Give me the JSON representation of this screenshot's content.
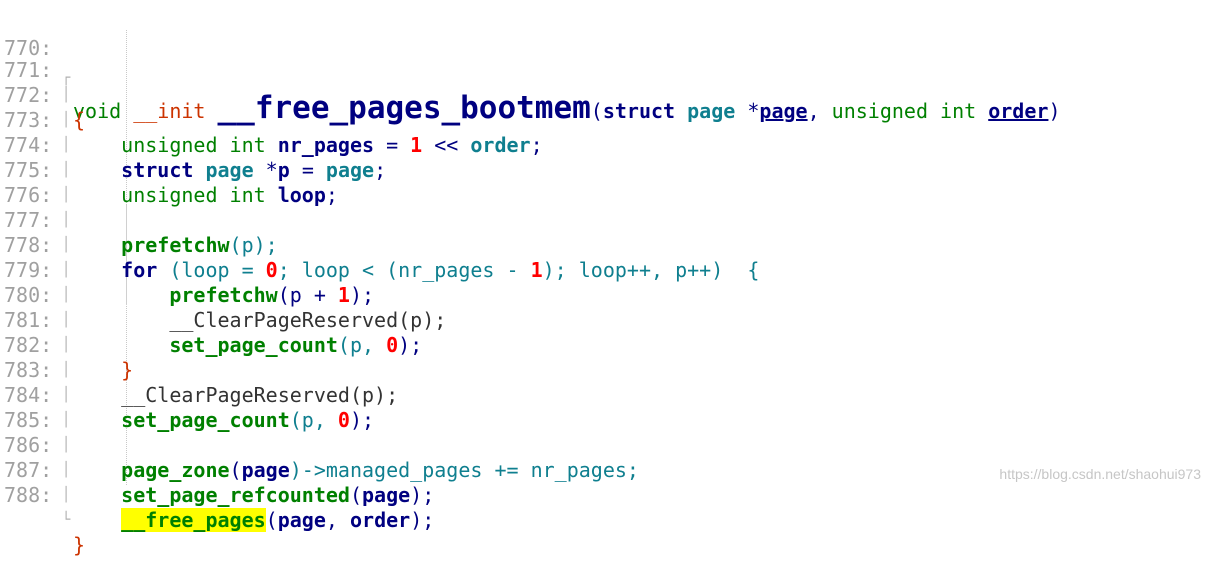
{
  "line_numbers": [
    "770:",
    "771:",
    "772:",
    "773:",
    "774:",
    "775:",
    "776:",
    "777:",
    "778:",
    "779:",
    "780:",
    "781:",
    "782:",
    "783:",
    "784:",
    "785:",
    "786:",
    "787:",
    "788:"
  ],
  "code": {
    "l770": {
      "void": "void",
      "init": "__init",
      "fn_name": "__free_pages_bootmem",
      "open_paren": "(",
      "struct": "struct",
      "type": "page",
      "star": " *",
      "param1": "page",
      "comma": ", ",
      "unsigned": "unsigned int",
      "param2": "order",
      "close_paren": ")"
    },
    "l771": {
      "brace": "{"
    },
    "l772": {
      "type": "unsigned int",
      "var": "nr_pages",
      "eq": " = ",
      "num": "1",
      "op": " << ",
      "rhs": "order",
      "semi": ";"
    },
    "l773": {
      "kw": "struct",
      "type": "page",
      "star": " *",
      "var": "p",
      "eq": " = ",
      "rhs": "page",
      "semi": ";"
    },
    "l774": {
      "type": "unsigned int",
      "var": "loop",
      "semi": ";"
    },
    "l776": {
      "fn": "prefetchw",
      "rest": "(p);"
    },
    "l777": {
      "kw": "for",
      "a": " (loop = ",
      "n0": "0",
      "b": "; loop < (nr_pages - ",
      "n1": "1",
      "c": "); loop++, p++)  {"
    },
    "l778": {
      "fn": "prefetchw",
      "a": "(p + ",
      "n": "1",
      "b": ");"
    },
    "l779": {
      "rest": "__ClearPageReserved(p);"
    },
    "l780": {
      "fn": "set_page_count",
      "a": "(p, ",
      "n": "0",
      "b": ");"
    },
    "l781": {
      "brace": "}"
    },
    "l782": {
      "rest": "__ClearPageReserved(p);"
    },
    "l783": {
      "fn": "set_page_count",
      "a": "(p, ",
      "n": "0",
      "b": ");"
    },
    "l785": {
      "fn": "page_zone",
      "a": "(",
      "arg": "page",
      "b": ")->managed_pages += nr_pages;"
    },
    "l786": {
      "fn": "set_page_refcounted",
      "a": "(",
      "arg": "page",
      "b": ");"
    },
    "l787": {
      "fn": "__free_pages",
      "a": "(",
      "arg1": "page",
      "comma": ", ",
      "arg2": "order",
      "b": ");"
    },
    "l788": {
      "brace": "}"
    }
  },
  "watermark": "https://blog.csdn.net/shaohui973",
  "colors": {
    "keyword_green": "#008000",
    "identifier_navy": "#000080",
    "number_red": "#ff0000",
    "highlight_yellow": "#ffff00",
    "line_number_gray": "#a0a0a0"
  }
}
